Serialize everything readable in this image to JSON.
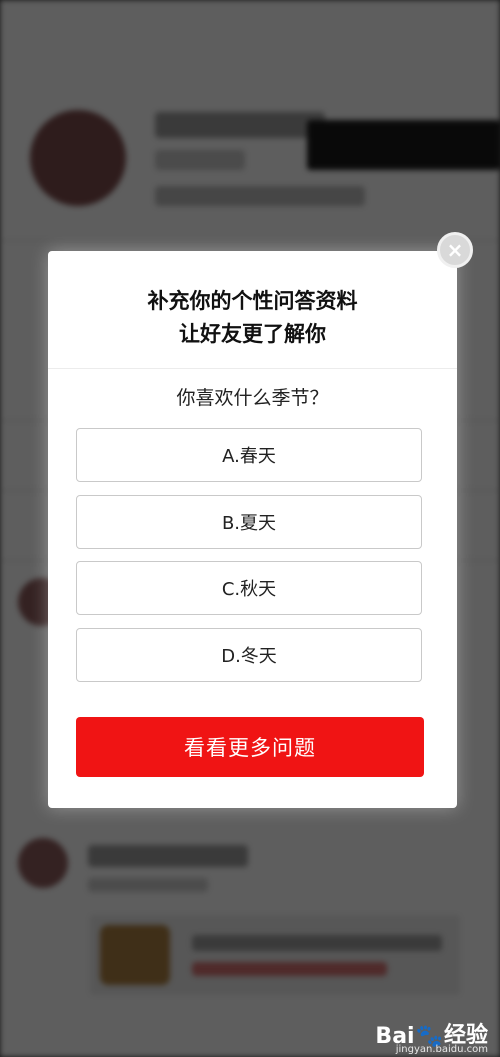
{
  "modal": {
    "title_line1": "补充你的个性问答资料",
    "title_line2": "让好友更了解你",
    "question": "你喜欢什么季节？",
    "options": [
      {
        "label": "A.春天"
      },
      {
        "label": "B.夏天"
      },
      {
        "label": "C.秋天"
      },
      {
        "label": "D.冬天"
      }
    ],
    "cta_label": "看看更多问题",
    "close_symbol": "×"
  },
  "watermark": {
    "logo_text": "Bai",
    "logo_paw": "🐾",
    "logo_suffix": "经验",
    "url": "jingyan.baidu.com"
  },
  "colors": {
    "cta": "#f01414",
    "overlay": "rgba(0,0,0,0.62)"
  }
}
